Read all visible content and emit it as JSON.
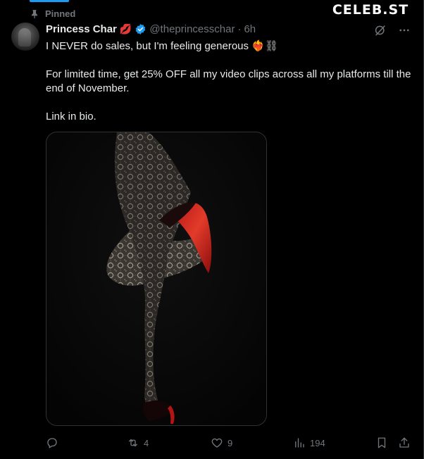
{
  "watermark": "CELEB.ST",
  "pinned_label": "Pinned",
  "author": {
    "name": "Princess Char",
    "name_emoji": "💋",
    "handle": "@theprincesschar",
    "separator": "·",
    "time": "6h"
  },
  "tweet": {
    "line1": "I NEVER do sales, but I'm feeling generous",
    "line1_emoji_fire": "❤️‍🔥",
    "line1_emoji_chain": "⛓",
    "line2": "For limited time, get 25% OFF all my video clips across all my platforms till the end of November.",
    "line3": "Link in bio."
  },
  "stats": {
    "replies": "",
    "retweets": "4",
    "likes": "9",
    "views": "194"
  },
  "colors": {
    "accent": "#1d9bf0",
    "muted": "#71767b",
    "verified": "#1d9bf0",
    "heel_red": "#d61f1f"
  },
  "icons": [
    "pin-icon",
    "verified-badge-icon",
    "grok-icon",
    "more-icon",
    "reply-icon",
    "retweet-icon",
    "like-icon",
    "views-icon",
    "bookmark-icon",
    "share-icon"
  ]
}
